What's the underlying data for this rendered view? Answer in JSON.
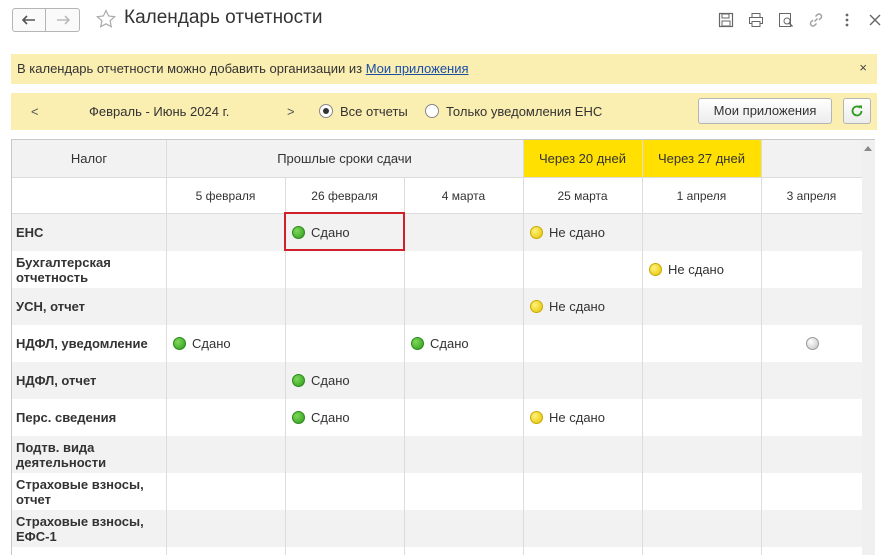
{
  "window": {
    "title": "Календарь отчетности",
    "toolbar_icons": [
      "save-icon",
      "print-icon",
      "preview-icon",
      "link-icon",
      "more-icon",
      "close-icon"
    ]
  },
  "banner": {
    "text": "В календарь отчетности можно добавить организации из ",
    "link": "Мои приложения",
    "close": "×"
  },
  "filter": {
    "prev": "<",
    "period": "Февраль - Июнь 2024 г.",
    "next": ">",
    "option_all": "Все отчеты",
    "option_ens": "Только уведомления ЕНС",
    "selected": "option_all",
    "apps_button": "Мои приложения"
  },
  "table": {
    "tax_header": "Налог",
    "past_header": "Прошлые сроки сдачи",
    "in20_header": "Через 20 дней",
    "in27_header": "Через 27 дней",
    "dates": [
      "5 февраля",
      "26 февраля",
      "4 марта",
      "25 марта",
      "1 апреля",
      "3 апреля"
    ],
    "rows": [
      {
        "name": "ЕНС",
        "c1": "Сдано",
        "c3": "Не сдано"
      },
      {
        "name": "Бухгалтерская отчетность",
        "c4": "Не сдано"
      },
      {
        "name": "УСН, отчет",
        "c3": "Не сдано"
      },
      {
        "name": "НДФЛ, уведомление",
        "c0": "Сдано",
        "c2": "Сдано"
      },
      {
        "name": "НДФЛ, отчет",
        "c1": "Сдано"
      },
      {
        "name": "Перс. сведения",
        "c1": "Сдано",
        "c3": "Не сдано"
      },
      {
        "name": "Подтв. вида деятельности"
      },
      {
        "name": "Страховые взносы, отчет"
      },
      {
        "name": "Страховые взносы, ЕФС-1"
      }
    ],
    "status_colors": {
      "done": "#3aa62a",
      "not_done": "#f0d400",
      "pending": "#cccccc"
    }
  }
}
